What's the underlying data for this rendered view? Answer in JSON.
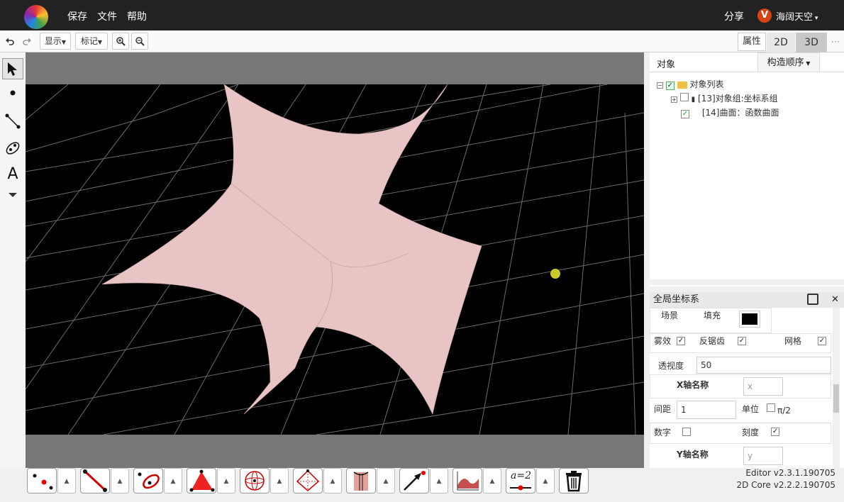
{
  "header": {
    "menu": [
      "保存",
      "文件",
      "帮助"
    ],
    "share_label": "分享",
    "user_badge": "V",
    "user_name": "海阔天空"
  },
  "toolbar": {
    "undo_icon": "undo-icon",
    "redo_icon": "redo-icon",
    "display_label": "显示",
    "mark_label": "标记",
    "zoom_in_icon": "zoom-in-icon",
    "zoom_out_icon": "zoom-out-icon",
    "properties_tab": "属性",
    "tab_2d": "2D",
    "tab_3d": "3D",
    "more": "⋯"
  },
  "left_tools": [
    "select-arrow-icon",
    "point-icon",
    "segment-icon",
    "conic-icon",
    "text-icon",
    "more-down-icon"
  ],
  "left_text_tool": "A",
  "object_panel": {
    "title": "对象",
    "order_label": "构造顺序",
    "root_label": "对象列表",
    "items": [
      {
        "label": "[13]对象组:坐标系组",
        "checked": false
      },
      {
        "label": "[14]曲面：函数曲面",
        "checked": true
      }
    ]
  },
  "props_panel": {
    "title": "全局坐标系",
    "scene_label": "场景",
    "fill_label": "填充",
    "fill_color": "#000000",
    "fog_label": "雾效",
    "fog_checked": true,
    "antialias_label": "反锯齿",
    "antialias_checked": true,
    "grid_label": "网格",
    "grid_checked": true,
    "perspective_label": "透视度",
    "perspective_value": "50",
    "x_axis_name_label": "X轴名称",
    "x_axis_name_placeholder": "x",
    "spacing_label": "间距",
    "spacing_value": "1",
    "unit_label": "单位",
    "unit_pi_label": "π/2",
    "unit_checked": false,
    "numbers_label": "数字",
    "numbers_checked": false,
    "ticks_label": "刻度",
    "ticks_checked": true,
    "y_axis_name_label": "Y轴名称",
    "y_axis_name_placeholder": "y"
  },
  "bottom_tools": [
    "point-tool-icon",
    "line-tool-icon",
    "circle-tool-icon",
    "polygon-tool-icon",
    "sphere-tool-icon",
    "polyhedron-tool-icon",
    "surface-tool-icon",
    "vector-tool-icon",
    "function-surface-tool-icon",
    "slider-tool-icon",
    "trash-icon"
  ],
  "bottom_slider_label": "a=2",
  "version": {
    "editor": "Editor v2.3.1.190705",
    "core": "2D Core v2.2.2.190705"
  },
  "colors": {
    "surface": "#e8c4c4",
    "canvas_bg": "#000000",
    "margin_bg": "#777777",
    "marker": "#c9c92a"
  }
}
